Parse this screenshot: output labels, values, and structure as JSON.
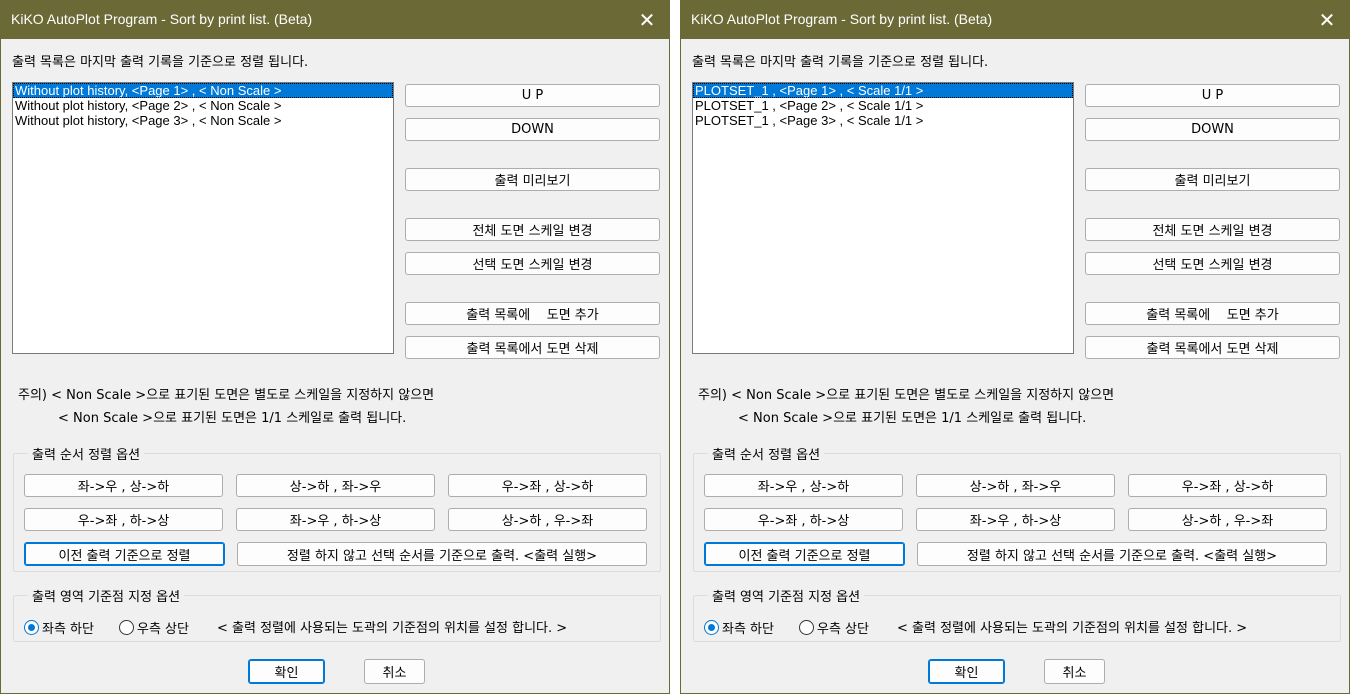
{
  "windows": [
    {
      "title": "KiKO AutoPlot Program - Sort by print list. (Beta)",
      "close_glyph": "✕",
      "info_text": "출력 목록은 마지막 출력 기록을 기준으로 정렬 됩니다.",
      "list_items": [
        "Without plot history, <Page 1> , < Non Scale >",
        "Without plot history, <Page 2> , < Non Scale >",
        "Without plot history, <Page 3> , < Non Scale >"
      ],
      "buttons": {
        "up": "U P",
        "down": "DOWN",
        "preview": "출력 미리보기",
        "scale_all": "전체 도면 스케일 변경",
        "scale_selected": "선택 도면 스케일 변경",
        "add_drawing": "출력 목록에    도면 추가",
        "remove_drawing": "출력 목록에서 도면 삭제"
      },
      "note_line1": "주의) < Non Scale >으로 표기된 도면은 별도로 스케일을 지정하지 않으면",
      "note_line2": "< Non Scale >으로 표기된 도면은 1/1 스케일로 출력 됩니다.",
      "sort_group": {
        "label": "출력 순서 정렬 옵션",
        "row1": [
          "좌->우 , 상->하",
          "상->하 , 좌->우",
          "우->좌 , 상->하"
        ],
        "row2": [
          "우->좌 , 하->상",
          "좌->우 , 하->상",
          "상->하 , 우->좌"
        ],
        "prev_sort": "이전 출력 기준으로 정렬",
        "no_sort": "정렬 하지 않고 선택 순서를 기준으로 출력. <출력 실행>"
      },
      "origin_group": {
        "label": "출력 영역 기준점 지정 옵션",
        "radio_bottom_left": "좌측 하단",
        "radio_top_right": "우측 상단",
        "description": "< 출력 정렬에 사용되는 도곽의 기준점의 위치를 설정 합니다. >"
      },
      "ok": "확인",
      "cancel": "취소"
    },
    {
      "title": "KiKO AutoPlot Program - Sort by print list. (Beta)",
      "close_glyph": "✕",
      "info_text": "출력 목록은 마지막 출력 기록을 기준으로 정렬 됩니다.",
      "list_items": [
        "PLOTSET_1 , <Page 1> , < Scale 1/1 >",
        "PLOTSET_1 , <Page 2> , < Scale 1/1 >",
        "PLOTSET_1 , <Page 3> , < Scale 1/1 >"
      ],
      "buttons": {
        "up": "U P",
        "down": "DOWN",
        "preview": "출력 미리보기",
        "scale_all": "전체 도면 스케일 변경",
        "scale_selected": "선택 도면 스케일 변경",
        "add_drawing": "출력 목록에    도면 추가",
        "remove_drawing": "출력 목록에서 도면 삭제"
      },
      "note_line1": "주의) < Non Scale >으로 표기된 도면은 별도로 스케일을 지정하지 않으면",
      "note_line2": "< Non Scale >으로 표기된 도면은 1/1 스케일로 출력 됩니다.",
      "sort_group": {
        "label": "출력 순서 정렬 옵션",
        "row1": [
          "좌->우 , 상->하",
          "상->하 , 좌->우",
          "우->좌 , 상->하"
        ],
        "row2": [
          "우->좌 , 하->상",
          "좌->우 , 하->상",
          "상->하 , 우->좌"
        ],
        "prev_sort": "이전 출력 기준으로 정렬",
        "no_sort": "정렬 하지 않고 선택 순서를 기준으로 출력. <출력 실행>"
      },
      "origin_group": {
        "label": "출력 영역 기준점 지정 옵션",
        "radio_bottom_left": "좌측 하단",
        "radio_top_right": "우측 상단",
        "description": "< 출력 정렬에 사용되는 도곽의 기준점의 위치를 설정 합니다. >"
      },
      "ok": "확인",
      "cancel": "취소"
    }
  ]
}
